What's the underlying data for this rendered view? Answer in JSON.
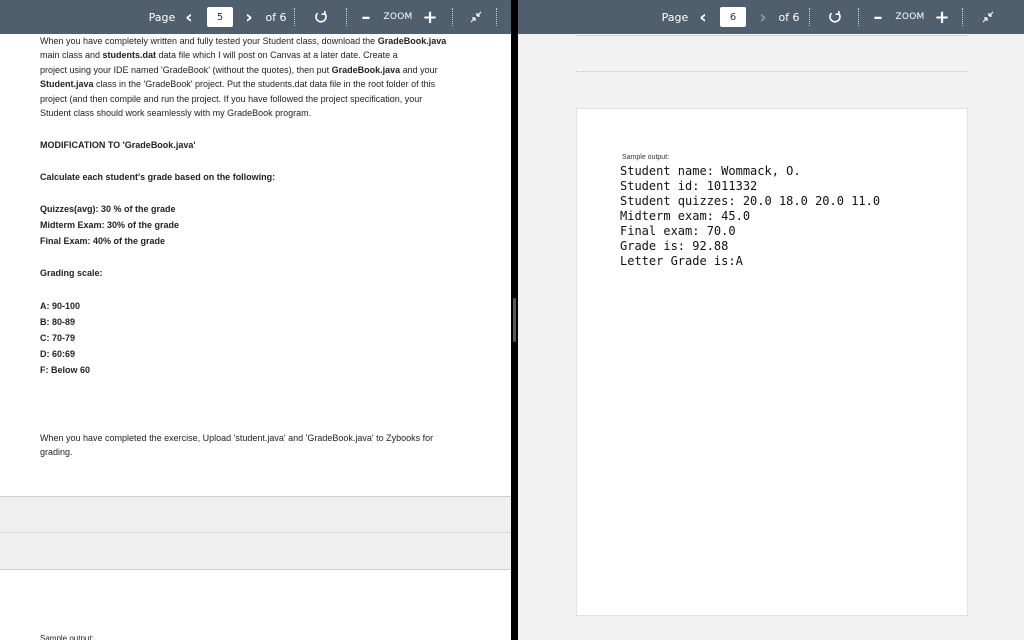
{
  "left_viewer": {
    "toolbar": {
      "page_label": "Page",
      "page_value": "5",
      "of_label": "of 6",
      "zoom_label": "ZOOM"
    },
    "document": {
      "intro_lines": [
        [
          "When you have completely written and fully tested your Student class, download the ",
          "GradeBook.java",
          ""
        ],
        [
          "main class and ",
          "students.dat",
          " data file which I will post on Canvas at a later date.  Create a"
        ],
        [
          "project using your IDE named 'GradeBook' (without the quotes), then put ",
          "GradeBook.java",
          " and your"
        ],
        [
          "",
          "Student.java",
          " class in the 'GradeBook' project.  Put the students.dat data file in the root folder of this"
        ],
        [
          "project (and then compile and run the project.  If you have followed the project specification, your",
          "",
          ""
        ],
        [
          "Student class should work seamlessly with my GradeBook program.",
          "",
          ""
        ]
      ],
      "modification_heading": "MODIFICATION TO 'GradeBook.java'",
      "calculate_heading": "Calculate each student's grade based on the following:",
      "weights": [
        "Quizzes(avg): 30 % of the grade",
        "Midterm Exam: 30% of the grade",
        "Final Exam: 40% of the grade"
      ],
      "grading_scale_heading": "Grading scale:",
      "scale": [
        "A: 90-100",
        "B: 80-89",
        "C: 70-79",
        "D: 60:69",
        "F: Below 60"
      ],
      "closing_lines": [
        "When you have completed the exercise, Upload 'student.java' and 'GradeBook.java' to Zybooks for",
        "grading."
      ],
      "next_page_peek": "Sample output:"
    }
  },
  "right_viewer": {
    "toolbar": {
      "page_label": "Page",
      "page_value": "6",
      "of_label": "of 6",
      "zoom_label": "ZOOM"
    },
    "document": {
      "sample_label": "Sample output:",
      "output_lines": [
        "Student name: Wommack, O.",
        "Student id: 1011332",
        "Student quizzes: 20.0 18.0 20.0 11.0",
        "Midterm exam: 45.0",
        "Final exam: 70.0",
        "Grade is: 92.88",
        "Letter Grade is:A"
      ]
    }
  }
}
